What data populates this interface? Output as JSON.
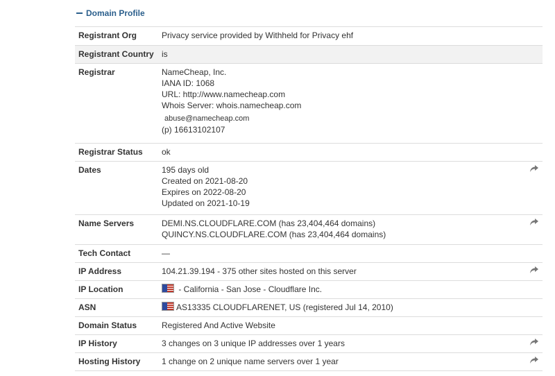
{
  "section": {
    "title": "Domain Profile"
  },
  "rows": {
    "registrant_org": {
      "label": "Registrant Org",
      "lines": [
        "Privacy service provided by Withheld for Privacy ehf"
      ]
    },
    "registrant_country": {
      "label": "Registrant Country",
      "lines": [
        "is"
      ]
    },
    "registrar": {
      "label": "Registrar",
      "name": "NameCheap, Inc.",
      "iana": "IANA ID: 1068",
      "url": "URL: http://www.namecheap.com",
      "whois": "Whois Server: whois.namecheap.com",
      "email": "abuse@namecheap.com",
      "phone": "(p)  16613102107"
    },
    "registrar_status": {
      "label": "Registrar Status",
      "lines": [
        "ok"
      ]
    },
    "dates": {
      "label": "Dates",
      "lines": [
        "195 days old",
        "Created on 2021-08-20",
        "Expires on 2022-08-20",
        "Updated on 2021-10-19"
      ]
    },
    "name_servers": {
      "label": "Name Servers",
      "lines": [
        "DEMI.NS.CLOUDFLARE.COM (has 23,404,464 domains)",
        "QUINCY.NS.CLOUDFLARE.COM (has 23,404,464 domains)"
      ]
    },
    "tech_contact": {
      "label": "Tech Contact",
      "lines": [
        "—"
      ]
    },
    "ip_address": {
      "label": "IP Address",
      "lines": [
        "104.21.39.194 - 375 other sites hosted on this server"
      ]
    },
    "ip_location": {
      "label": "IP Location",
      "text": " - California - San Jose - Cloudflare Inc."
    },
    "asn": {
      "label": "ASN",
      "text": "AS13335 CLOUDFLARENET, US (registered Jul 14, 2010)"
    },
    "domain_status": {
      "label": "Domain Status",
      "lines": [
        "Registered And Active Website"
      ]
    },
    "ip_history": {
      "label": "IP History",
      "lines": [
        "3 changes on 3 unique IP addresses over 1 years"
      ]
    },
    "hosting_history": {
      "label": "Hosting History",
      "lines": [
        "1 change on 2 unique name servers over 1 year"
      ]
    }
  },
  "icons": {
    "share": "share-arrow-icon",
    "flag": "us-flag-icon",
    "collapse": "minus-icon"
  }
}
